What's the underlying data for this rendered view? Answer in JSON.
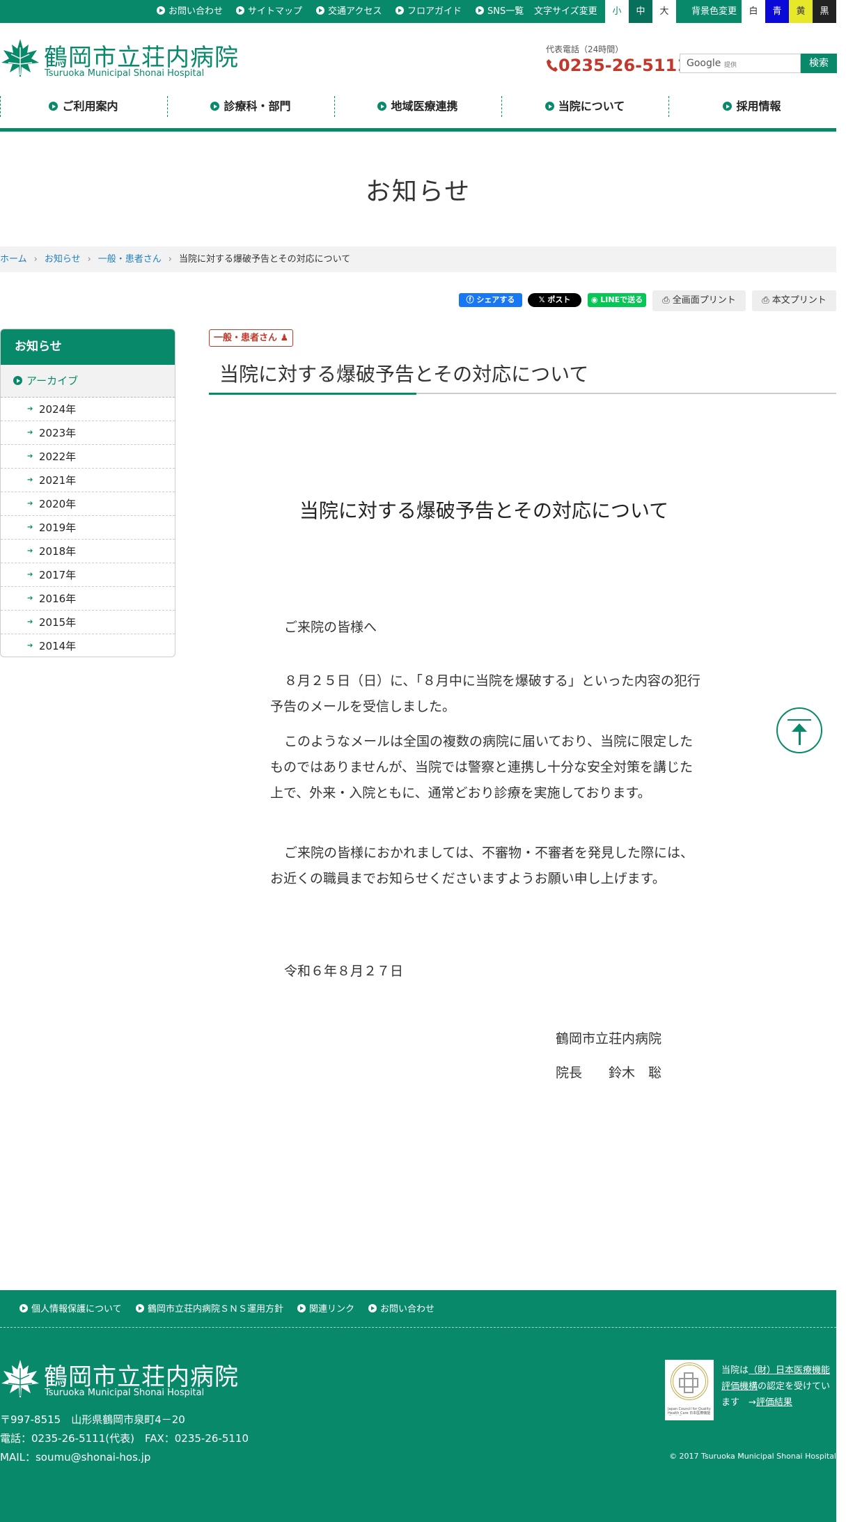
{
  "topbar": {
    "links": [
      "お問い合わせ",
      "サイトマップ",
      "交通アクセス",
      "フロアガイド",
      "SNS一覧"
    ],
    "font_size_label": "文字サイズ変更",
    "font_sizes": [
      "小",
      "中",
      "大"
    ],
    "bg_label": "背景色変更",
    "bg_colors": [
      "白",
      "青",
      "黄",
      "黒"
    ]
  },
  "header": {
    "name": "鶴岡市立荘内病院",
    "name_en": "Tsuruoka Municipal Shonai Hospital",
    "phone_label": "代表電話（24時間）",
    "phone": "0235-26-5111",
    "search_brand": "Google",
    "search_sub": "提供",
    "search_button": "検索"
  },
  "nav": [
    "ご利用案内",
    "診療科・部門",
    "地域医療連携",
    "当院について",
    "採用情報"
  ],
  "page_title": "お知らせ",
  "breadcrumb": [
    "ホーム",
    "お知らせ",
    "一般・患者さん",
    "当院に対する爆破予告とその対応について"
  ],
  "share": {
    "facebook": "シェアする",
    "x": "ポスト",
    "line": "LINEで送る",
    "print_all": "全画面プリント",
    "print_body": "本文プリント"
  },
  "sidebar": {
    "title": "お知らせ",
    "archive": "アーカイブ",
    "years": [
      "2024年",
      "2023年",
      "2022年",
      "2021年",
      "2020年",
      "2019年",
      "2018年",
      "2017年",
      "2016年",
      "2015年",
      "2014年"
    ]
  },
  "article": {
    "category": "一般・患者さん",
    "title": "当院に対する爆破予告とその対応について",
    "heading": "当院に対する爆破予告とその対応について",
    "greeting": "ご来院の皆様へ",
    "p1": "８月２５日（日）に、「８月中に当院を爆破する」といった内容の犯行予告のメールを受信しました。",
    "p2": "このようなメールは全国の複数の病院に届いており、当院に限定したものではありませんが、当院では警察と連携し十分な安全対策を講じた上で、外来・入院ともに、通常どおり診療を実施しております。",
    "p3": "ご来院の皆様におかれましては、不審物・不審者を発見した際には、お近くの職員までお知らせくださいますようお願い申し上げます。",
    "date": "令和６年８月２７日",
    "sign_org": "鶴岡市立荘内病院",
    "sign_title": "院長",
    "sign_name": "鈴木　聡"
  },
  "footer": {
    "links": [
      "個人情報保護について",
      "鶴岡市立荘内病院ＳＮＳ運用方針",
      "関連リンク",
      "お問い合わせ"
    ],
    "name": "鶴岡市立荘内病院",
    "name_en": "Tsuruoka Municipal Shonai Hospital",
    "address": "〒997-8515　山形県鶴岡市泉町4－20",
    "tel": "電話：0235-26-5111(代表)　FAX：0235-26-5110",
    "mail": "MAIL：soumu@shonai-hos.jp",
    "cert_pre": "当院は",
    "cert_link1": "（財）日本医療機能",
    "cert_link2": "評価機構",
    "cert_mid": "の認定を受けてい",
    "cert_end_pre": "ます　→",
    "cert_result": "評価結果",
    "badge_text": "Japan Council for Quality Health Care 日本医療機能評価機構",
    "copyright": "© 2017 Tsuruoka Municipal Shonai Hospital"
  },
  "colors": {
    "brand": "#088a6a",
    "phone": "#c0392b",
    "category": "#c0392b"
  }
}
